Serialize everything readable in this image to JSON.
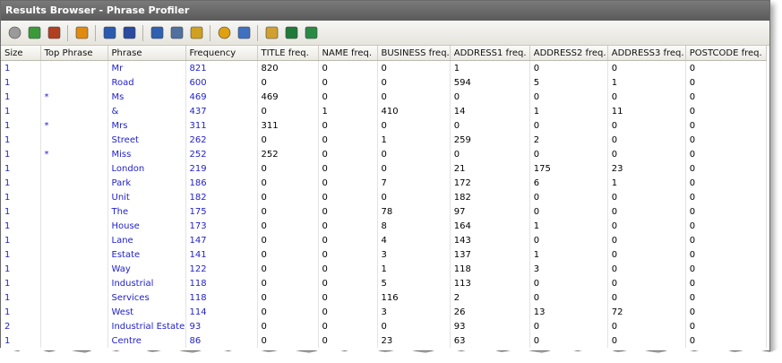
{
  "window": {
    "title": "Results Browser - Phrase Profiler"
  },
  "toolbar": {
    "buttons": [
      {
        "name": "back-icon",
        "color": "#9a9a9a"
      },
      {
        "name": "refresh-icon",
        "color": "#3a9a3a"
      },
      {
        "name": "home-icon",
        "color": "#b04020"
      },
      {
        "name": "filter-icon",
        "color": "#e08a10"
      },
      {
        "name": "export-icon",
        "color": "#2a5ab0"
      },
      {
        "name": "run-icon",
        "color": "#2a4aa0"
      },
      {
        "name": "info-icon",
        "color": "#3060b0"
      },
      {
        "name": "lookup-icon",
        "color": "#5070a0"
      },
      {
        "name": "save-icon",
        "color": "#d0a020"
      },
      {
        "name": "pie-chart-icon",
        "color": "#e0a010"
      },
      {
        "name": "graph-icon",
        "color": "#4070c0"
      },
      {
        "name": "notes-icon",
        "color": "#d0a030"
      },
      {
        "name": "excel-icon",
        "color": "#1f7a3a"
      },
      {
        "name": "excel-export-icon",
        "color": "#2a8a45"
      }
    ]
  },
  "table": {
    "columns": [
      "Size",
      "Top Phrase",
      "Phrase",
      "Frequency",
      "TITLE freq.",
      "NAME freq.",
      "BUSINESS freq.",
      "ADDRESS1 freq.",
      "ADDRESS2 freq.",
      "ADDRESS3 freq.",
      "POSTCODE freq."
    ],
    "rows": [
      [
        "1",
        "",
        "Mr",
        "821",
        "820",
        "0",
        "0",
        "1",
        "0",
        "0",
        "0"
      ],
      [
        "1",
        "",
        "Road",
        "600",
        "0",
        "0",
        "0",
        "594",
        "5",
        "1",
        "0"
      ],
      [
        "1",
        "*",
        "Ms",
        "469",
        "469",
        "0",
        "0",
        "0",
        "0",
        "0",
        "0"
      ],
      [
        "1",
        "",
        "&",
        "437",
        "0",
        "1",
        "410",
        "14",
        "1",
        "11",
        "0"
      ],
      [
        "1",
        "*",
        "Mrs",
        "311",
        "311",
        "0",
        "0",
        "0",
        "0",
        "0",
        "0"
      ],
      [
        "1",
        "",
        "Street",
        "262",
        "0",
        "0",
        "1",
        "259",
        "2",
        "0",
        "0"
      ],
      [
        "1",
        "*",
        "Miss",
        "252",
        "252",
        "0",
        "0",
        "0",
        "0",
        "0",
        "0"
      ],
      [
        "1",
        "",
        "London",
        "219",
        "0",
        "0",
        "0",
        "21",
        "175",
        "23",
        "0"
      ],
      [
        "1",
        "",
        "Park",
        "186",
        "0",
        "0",
        "7",
        "172",
        "6",
        "1",
        "0"
      ],
      [
        "1",
        "",
        "Unit",
        "182",
        "0",
        "0",
        "0",
        "182",
        "0",
        "0",
        "0"
      ],
      [
        "1",
        "",
        "The",
        "175",
        "0",
        "0",
        "78",
        "97",
        "0",
        "0",
        "0"
      ],
      [
        "1",
        "",
        "House",
        "173",
        "0",
        "0",
        "8",
        "164",
        "1",
        "0",
        "0"
      ],
      [
        "1",
        "",
        "Lane",
        "147",
        "0",
        "0",
        "4",
        "143",
        "0",
        "0",
        "0"
      ],
      [
        "1",
        "",
        "Estate",
        "141",
        "0",
        "0",
        "3",
        "137",
        "1",
        "0",
        "0"
      ],
      [
        "1",
        "",
        "Way",
        "122",
        "0",
        "0",
        "1",
        "118",
        "3",
        "0",
        "0"
      ],
      [
        "1",
        "",
        "Industrial",
        "118",
        "0",
        "0",
        "5",
        "113",
        "0",
        "0",
        "0"
      ],
      [
        "1",
        "",
        "Services",
        "118",
        "0",
        "0",
        "116",
        "2",
        "0",
        "0",
        "0"
      ],
      [
        "1",
        "",
        "West",
        "114",
        "0",
        "0",
        "3",
        "26",
        "13",
        "72",
        "0"
      ],
      [
        "2",
        "",
        "Industrial Estate",
        "93",
        "0",
        "0",
        "0",
        "93",
        "0",
        "0",
        "0"
      ],
      [
        "1",
        "",
        "Centre",
        "86",
        "0",
        "0",
        "23",
        "63",
        "0",
        "0",
        "0"
      ]
    ]
  }
}
